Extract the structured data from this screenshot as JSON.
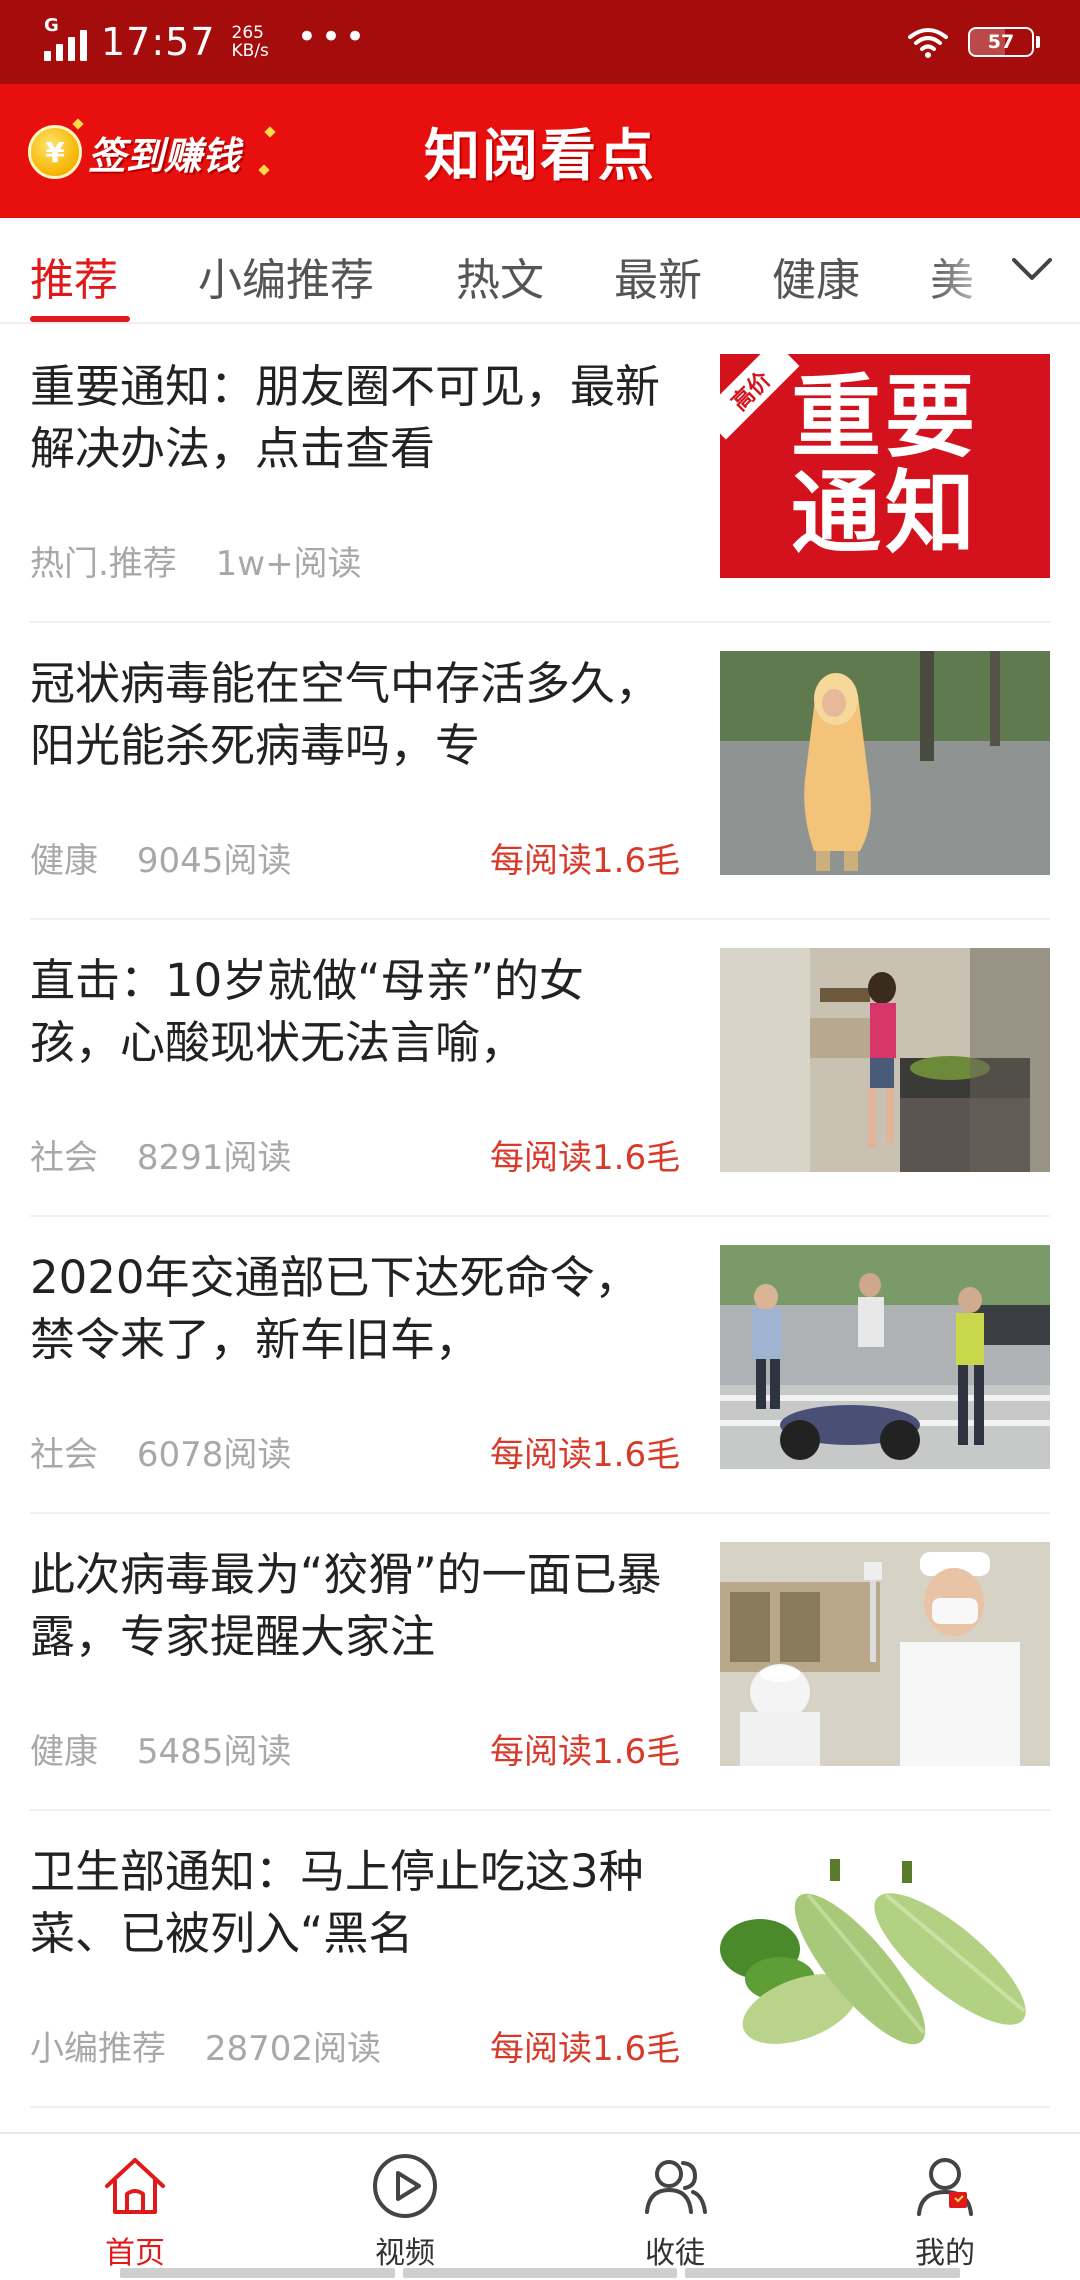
{
  "status_bar": {
    "network": "G",
    "time": "17:57",
    "speed_value": "265",
    "speed_unit": "KB/s",
    "more": "•••",
    "battery": "57",
    "battery_level": 0.57
  },
  "header": {
    "checkin_coin": "¥",
    "checkin_label": "签到赚钱",
    "title": "知阅看点"
  },
  "tabs": [
    {
      "label": "推荐",
      "active": true
    },
    {
      "label": "小编推荐",
      "active": false
    },
    {
      "label": "热文",
      "active": false
    },
    {
      "label": "最新",
      "active": false
    },
    {
      "label": "健康",
      "active": false
    },
    {
      "label": "美",
      "active": false
    }
  ],
  "articles": [
    {
      "title": "重要通知：朋友圈不可见，最新解决办法，点击查看",
      "category": "热门.推荐",
      "reads": "1w+阅读",
      "reward": "",
      "thumb": "notice",
      "thumb_text_1": "重要",
      "thumb_text_2": "通知",
      "thumb_corner": "高价"
    },
    {
      "title": "冠状病毒能在空气中存活多久，阳光能杀死病毒吗，专",
      "category": "健康",
      "reads": "9045阅读",
      "reward": "每阅读1.6毛",
      "thumb": "raincoat"
    },
    {
      "title": "直击：10岁就做“母亲”的女孩，心酸现状无法言喻，",
      "category": "社会",
      "reads": "8291阅读",
      "reward": "每阅读1.6毛",
      "thumb": "kitchen"
    },
    {
      "title": "2020年交通部已下达死命令，禁令来了，新车旧车，",
      "category": "社会",
      "reads": "6078阅读",
      "reward": "每阅读1.6毛",
      "thumb": "traffic"
    },
    {
      "title": "此次病毒最为“狡猾”的一面已暴露，专家提醒大家注",
      "category": "健康",
      "reads": "5485阅读",
      "reward": "每阅读1.6毛",
      "thumb": "nurse"
    },
    {
      "title": "卫生部通知：马上停止吃这3种菜、已被列入“黑名",
      "category": "小编推荐",
      "reads": "28702阅读",
      "reward": "每阅读1.6毛",
      "thumb": "zucchini"
    }
  ],
  "bottom_nav": [
    {
      "label": "首页",
      "icon": "home-icon",
      "active": true
    },
    {
      "label": "视频",
      "icon": "play-circle-icon",
      "active": false
    },
    {
      "label": "收徒",
      "icon": "users-icon",
      "active": false
    },
    {
      "label": "我的",
      "icon": "profile-icon",
      "active": false
    }
  ],
  "colors": {
    "status_bar": "#a50d0d",
    "header": "#e80f0f",
    "accent": "#e01a1a",
    "reward": "#d83a2a",
    "meta": "#a8a8a8"
  }
}
